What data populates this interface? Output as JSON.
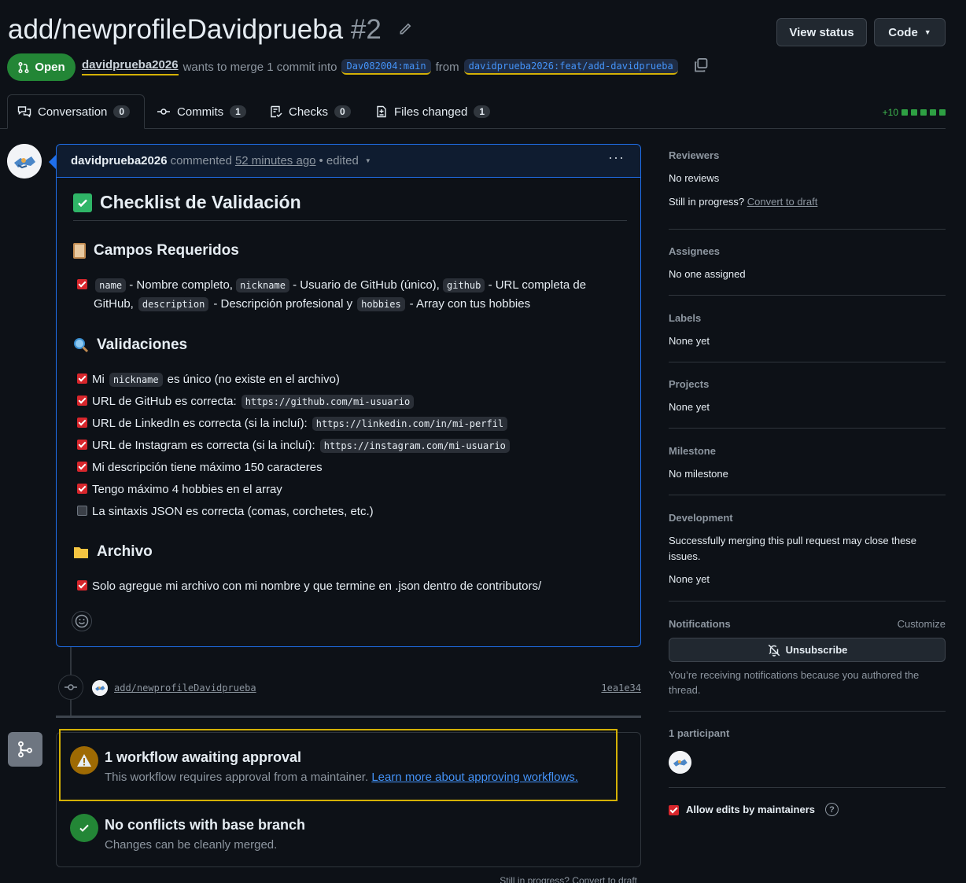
{
  "pr": {
    "title": "add/newprofileDavidprueba",
    "number": "#2",
    "state": "Open",
    "author": "davidprueba2026",
    "merge_text": "wants to merge 1 commit into",
    "base_branch": "Dav082004:main",
    "from_text": "from",
    "head_branch": "davidprueba2026:feat/add-davidprueba"
  },
  "buttons": {
    "view_status": "View status",
    "code": "Code"
  },
  "tabs": [
    {
      "label": "Conversation",
      "count": "0"
    },
    {
      "label": "Commits",
      "count": "1"
    },
    {
      "label": "Checks",
      "count": "0"
    },
    {
      "label": "Files changed",
      "count": "1"
    }
  ],
  "diffstat": "+10",
  "comment": {
    "author": "davidprueba2026",
    "action": "commented",
    "time": "52 minutes ago",
    "edited": "• edited",
    "menu": "···",
    "h1": "Checklist de Validación",
    "sec1": {
      "title": "Campos Requeridos",
      "line1_a": "- Nombre completo,",
      "line1_b": "- Usuario de GitHub (único),",
      "line1_c": "- URL completa de",
      "line2_a": "GitHub,",
      "line2_b": "- Descripción profesional y",
      "line2_c": "- Array con tus hobbies",
      "code_name": "name",
      "code_nickname": "nickname",
      "code_github": "github",
      "code_description": "description",
      "code_hobbies": "hobbies"
    },
    "sec2": {
      "title": "Validaciones",
      "items": [
        {
          "pre": "Mi",
          "code": "nickname",
          "post": "es único (no existe en el archivo)",
          "checked": true
        },
        {
          "pre": "URL de GitHub es correcta:",
          "code": "https://github.com/mi-usuario",
          "post": "",
          "checked": true
        },
        {
          "pre": "URL de LinkedIn es correcta (si la incluí):",
          "code": "https://linkedin.com/in/mi-perfil",
          "post": "",
          "checked": true
        },
        {
          "pre": "URL de Instagram es correcta (si la incluí):",
          "code": "https://instagram.com/mi-usuario",
          "post": "",
          "checked": true
        },
        {
          "pre": "Mi descripción tiene máximo 150 caracteres",
          "code": "",
          "post": "",
          "checked": true
        },
        {
          "pre": "Tengo máximo 4 hobbies en el array",
          "code": "",
          "post": "",
          "checked": true
        },
        {
          "pre": "La sintaxis JSON es correcta (comas, corchetes, etc.)",
          "code": "",
          "post": "",
          "checked": false
        }
      ]
    },
    "sec3": {
      "title": "Archivo",
      "item": "Solo agregue mi archivo con mi nombre y que termine en .json dentro de contributors/"
    }
  },
  "commit": {
    "message": "add/newprofileDavidprueba",
    "sha": "1ea1e34"
  },
  "merge_box": {
    "workflow_title": "1 workflow awaiting approval",
    "workflow_sub": "This workflow requires approval from a maintainer.",
    "workflow_link": "Learn more about approving workflows.",
    "conflict_title": "No conflicts with base branch",
    "conflict_sub": "Changes can be cleanly merged.",
    "clipped": "Still in progress? Convert to draft"
  },
  "sidebar": {
    "reviewers": {
      "heading": "Reviewers",
      "value": "No reviews",
      "draft_q": "Still in progress?",
      "draft_link": "Convert to draft"
    },
    "assignees": {
      "heading": "Assignees",
      "value": "No one assigned"
    },
    "labels": {
      "heading": "Labels",
      "value": "None yet"
    },
    "projects": {
      "heading": "Projects",
      "value": "None yet"
    },
    "milestone": {
      "heading": "Milestone",
      "value": "No milestone"
    },
    "development": {
      "heading": "Development",
      "text": "Successfully merging this pull request may close these issues.",
      "value": "None yet"
    },
    "notifications": {
      "heading": "Notifications",
      "customize": "Customize",
      "button": "Unsubscribe",
      "reason": "You’re receiving notifications because you authored the thread."
    },
    "participants": {
      "heading": "1 participant"
    },
    "allow_edits": "Allow edits by maintainers"
  },
  "colors": {
    "open": "#238636",
    "accent": "#4493f8",
    "highlight": "#d4b106",
    "checkbox": "#d7262c"
  }
}
